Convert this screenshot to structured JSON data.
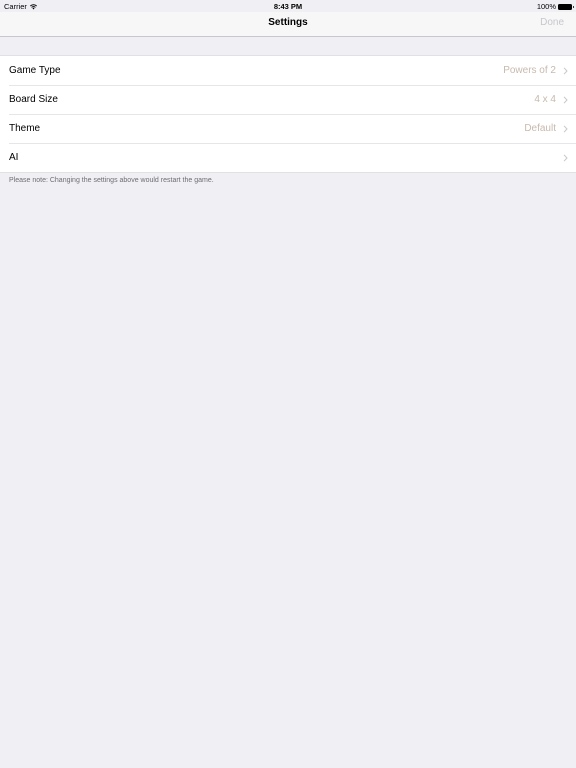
{
  "status_bar": {
    "carrier": "Carrier",
    "time": "8:43 PM",
    "battery": "100%"
  },
  "nav": {
    "title": "Settings",
    "done_label": "Done"
  },
  "settings": {
    "rows": [
      {
        "label": "Game Type",
        "value": "Powers of 2"
      },
      {
        "label": "Board Size",
        "value": "4 x 4"
      },
      {
        "label": "Theme",
        "value": "Default"
      },
      {
        "label": "AI",
        "value": ""
      }
    ],
    "footer_note": "Please note: Changing the settings above would restart the game."
  },
  "colors": {
    "background": "#efeff4",
    "value_text": "#c8b9ae",
    "done_disabled": "#c7c7cc"
  },
  "icons": [
    "wifi-icon",
    "battery-icon",
    "chevron-right-icon"
  ]
}
